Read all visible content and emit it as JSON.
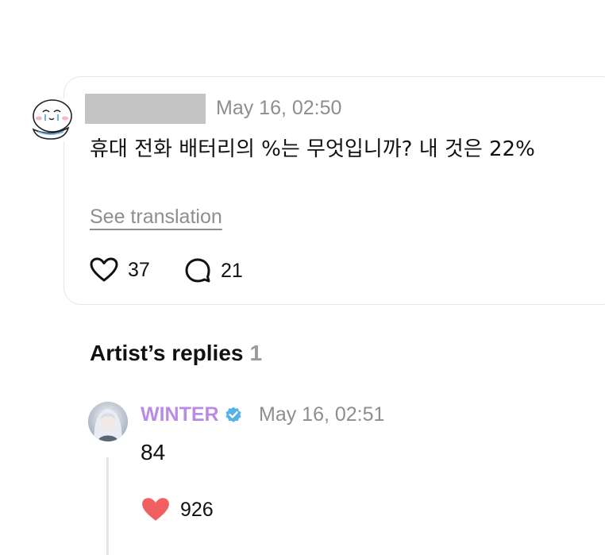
{
  "post": {
    "timestamp": "May 16, 02:50",
    "text": "휴대 전화 배터리의 %는 무엇입니까? 내 것은 22%",
    "translate_label": "See translation",
    "likes": "37",
    "comments": "21"
  },
  "replies_section": {
    "title": "Artist’s replies",
    "count": "1"
  },
  "reply": {
    "author": "WINTER",
    "timestamp": "May 16, 02:51",
    "text": "84",
    "likes": "926"
  },
  "colors": {
    "artist_name": "#b98be6",
    "verified_badge": "#54b3e6",
    "liked_heart": "#f06060",
    "muted_text": "#8e8e8e"
  },
  "icons": {
    "like": "heart-outline-icon",
    "comment": "speech-bubble-icon",
    "verified": "verified-badge-icon",
    "liked": "heart-filled-icon"
  }
}
